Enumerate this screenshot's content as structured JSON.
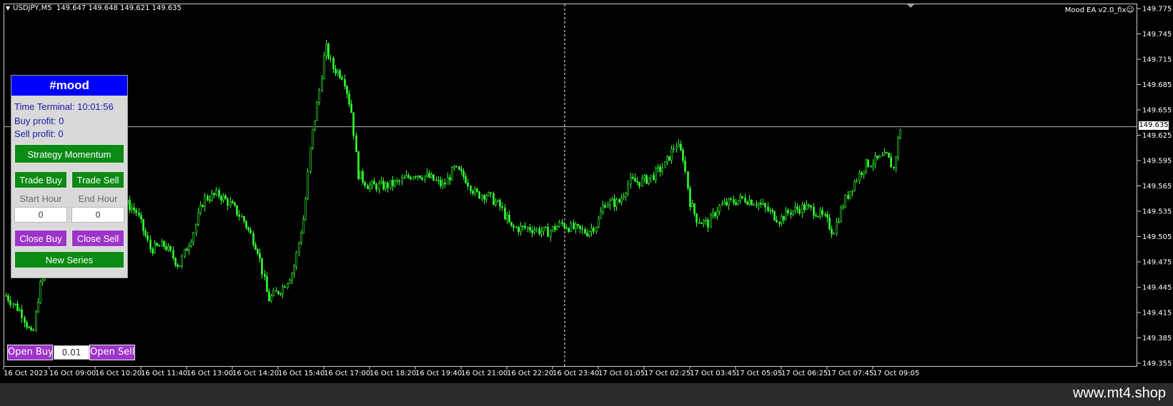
{
  "chart": {
    "symbol": "USDJPY,M5",
    "ohlc": "149.647 149.648 149.621 149.635",
    "ea_label": "Mood EA  v2.0_fix",
    "current_price": "149.635",
    "price_labels": [
      "149.775",
      "149.745",
      "149.715",
      "149.685",
      "149.655",
      "149.625",
      "149.595",
      "149.565",
      "149.535",
      "149.505",
      "149.475",
      "149.445",
      "149.415",
      "149.385",
      "149.355"
    ],
    "time_labels": [
      "16 Oct 2023",
      "16 Oct 09:00",
      "16 Oct 10:20",
      "16 Oct 11:40",
      "16 Oct 13:00",
      "16 Oct 14:20",
      "16 Oct 15:40",
      "16 Oct 17:00",
      "16 Oct 18:20",
      "16 Oct 19:40",
      "16 Oct 21:00",
      "16 Oct 22:20",
      "16 Oct 23:40",
      "17 Oct 01:05",
      "17 Oct 02:25",
      "17 Oct 03:45",
      "17 Oct 05:05",
      "17 Oct 06:25",
      "17 Oct 07:45",
      "17 Oct 09:05"
    ],
    "candle_color": "#33ff33",
    "background": "#000000"
  },
  "panel": {
    "title": "#mood",
    "time_terminal": "Time Terminal: 10:01:56",
    "buy_profit": "Buy profit: 0",
    "sell_profit": "Sell profit: 0",
    "strategy_button": "Strategy Momentum",
    "trade_buy": "Trade Buy",
    "trade_sell": "Trade Sell",
    "start_hour_label": "Start Hour",
    "end_hour_label": "End Hour",
    "start_hour_value": "0",
    "end_hour_value": "0",
    "close_buy": "Close Buy",
    "close_sell": "Close Sell",
    "new_series": "New Series",
    "header_color": "#0000ff",
    "green_color": "#0b8a14",
    "purple_color": "#9e34c9"
  },
  "trade_bar": {
    "open_buy": "Open Buy",
    "lot_value": "0.01",
    "open_sell": "Open Sell"
  },
  "watermark": "www.mt4.shop"
}
